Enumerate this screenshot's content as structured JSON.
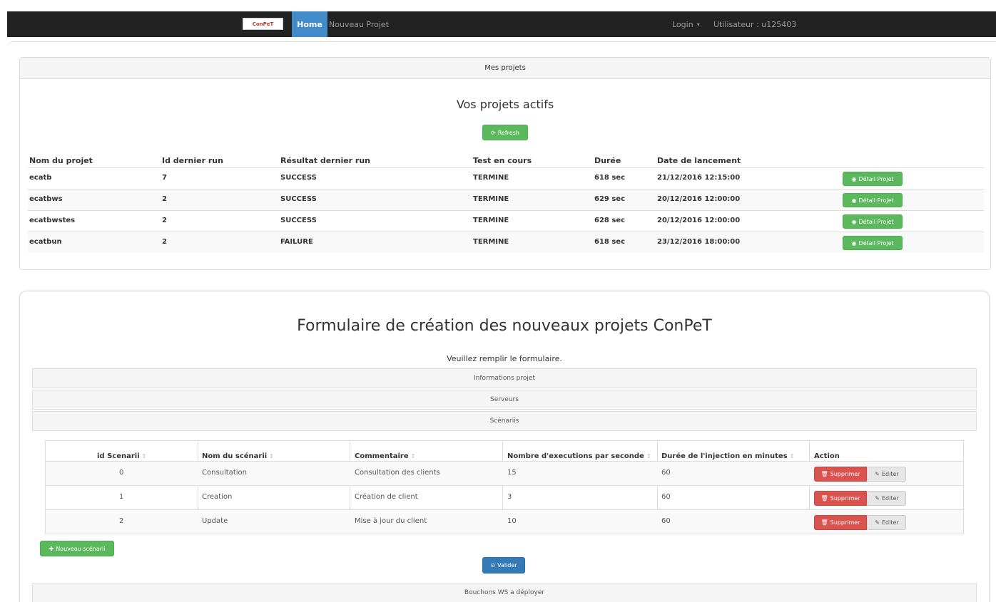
{
  "navbar": {
    "brand": "ConPeT",
    "home": "Home",
    "new_project": "Nouveau Projet",
    "login": "Login",
    "user": "Utilisateur : u125403"
  },
  "projects": {
    "heading": "Mes projets",
    "title": "Vos projets actifs",
    "refresh_label": "Refresh",
    "columns": [
      "Nom du projet",
      "Id dernier run",
      "Résultat dernier run",
      "Test en cours",
      "Durée",
      "Date de lancement"
    ],
    "detail_label": "Détail Projet",
    "rows": [
      {
        "name": "ecatb",
        "id": "7",
        "result": "SUCCESS",
        "status": "TERMINE",
        "duration": "618 sec",
        "date": "21/12/2016 12:15:00"
      },
      {
        "name": "ecatbws",
        "id": "2",
        "result": "SUCCESS",
        "status": "TERMINE",
        "duration": "629 sec",
        "date": "20/12/2016 12:00:00"
      },
      {
        "name": "ecatbwstes",
        "id": "2",
        "result": "SUCCESS",
        "status": "TERMINE",
        "duration": "628 sec",
        "date": "20/12/2016 12:00:00"
      },
      {
        "name": "ecatbun",
        "id": "2",
        "result": "FAILURE",
        "status": "TERMINE",
        "duration": "618 sec",
        "date": "23/12/2016 18:00:00"
      }
    ]
  },
  "form": {
    "title": "Formulaire de création des nouveaux projets ConPeT",
    "subtitle": "Veuillez remplir le formulaire.",
    "section_info": "Informations projet",
    "section_servers": "Serveurs",
    "section_scenarios": "Scénariis",
    "section_stubs": "Bouchons WS a déployer",
    "scenario_columns": [
      "id Scenarii",
      "Nom du scénarii",
      "Commentaire",
      "Nombre d'executions par seconde",
      "Durée de l'injection en minutes",
      "Action"
    ],
    "delete_label": "Supprimer",
    "edit_label": "Editer",
    "scenarios": [
      {
        "id": "0",
        "name": "Consultation",
        "comment": "Consultation des clients",
        "rate": "15",
        "duration": "60"
      },
      {
        "id": "1",
        "name": "Creation",
        "comment": "Création de client",
        "rate": "3",
        "duration": "60"
      },
      {
        "id": "2",
        "name": "Update",
        "comment": "Mise à jour du client",
        "rate": "10",
        "duration": "60"
      }
    ],
    "new_scenario_label": "Nouveau scénarii",
    "validate_label": "Valider"
  },
  "colors": {
    "navbar": "#222222",
    "primary": "#428bca",
    "success": "#5cb85c",
    "danger": "#d9534f"
  }
}
